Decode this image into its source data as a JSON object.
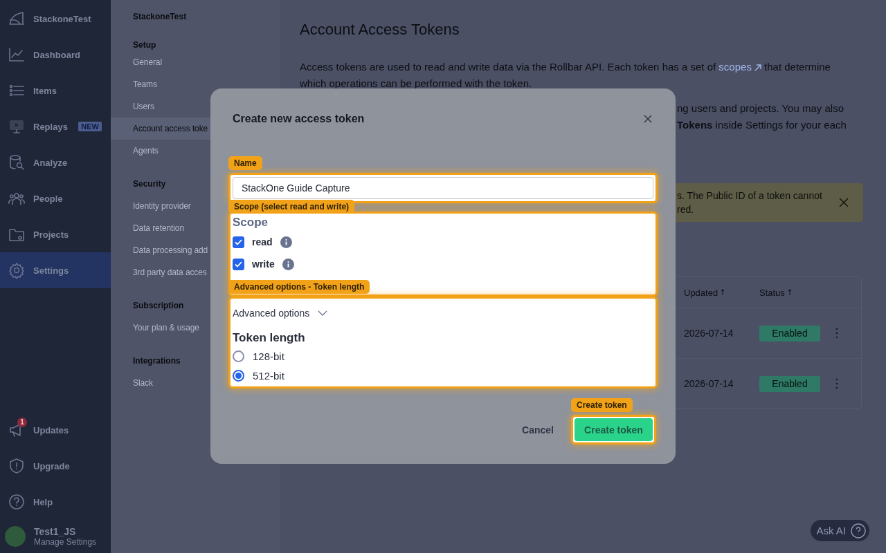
{
  "rail": {
    "brand": "StackoneTest",
    "items": [
      {
        "label": "Dashboard",
        "selected": false
      },
      {
        "label": "Items",
        "selected": false
      },
      {
        "label": "Replays",
        "selected": false,
        "badge": "NEW"
      },
      {
        "label": "Analyze",
        "selected": false
      },
      {
        "label": "People",
        "selected": false
      },
      {
        "label": "Projects",
        "selected": false
      },
      {
        "label": "Settings",
        "selected": true
      }
    ],
    "bottom_items": [
      {
        "label": "Updates",
        "badge": "1"
      },
      {
        "label": "Upgrade"
      },
      {
        "label": "Help"
      }
    ],
    "user": {
      "name": "Test1_JS",
      "subtitle": "Manage Settings"
    }
  },
  "settings_nav": {
    "title": "StackoneTest",
    "sections": [
      {
        "heading": "Setup",
        "items": [
          {
            "label": "General",
            "selected": false
          },
          {
            "label": "Teams",
            "selected": false
          },
          {
            "label": "Users",
            "selected": false
          },
          {
            "label": "Account access toke",
            "selected": true
          },
          {
            "label": "Agents",
            "selected": false
          }
        ]
      },
      {
        "heading": "Security",
        "items": [
          {
            "label": "Identity provider",
            "selected": false
          },
          {
            "label": "Data retention",
            "selected": false
          },
          {
            "label": "Data processing add",
            "selected": false
          },
          {
            "label": "3rd party data acces",
            "selected": false
          }
        ]
      },
      {
        "heading": "Subscription",
        "items": [
          {
            "label": "Your plan & usage",
            "selected": false
          }
        ]
      },
      {
        "heading": "Integrations",
        "items": [
          {
            "label": "Slack",
            "selected": false
          }
        ]
      }
    ]
  },
  "page": {
    "title": "Account Access Tokens",
    "intro": {
      "before": "Access tokens are used to read and write data via the Rollbar API. Each token has a set of ",
      "link": "scopes",
      "after": " that determine which operations can be performed with the token."
    },
    "note_lines": [
      "ng users and projects. You may also",
      "**Tokens** inside Settings for your each"
    ],
    "alert_lines": [
      "s. The Public ID of a token cannot",
      "red."
    ],
    "table": {
      "columns": [
        {
          "label": "Updated"
        },
        {
          "label": "Status"
        }
      ],
      "rows": [
        {
          "updated": "2026-07-14",
          "status": "Enabled"
        },
        {
          "updated": "2026-07-14",
          "status": "Enabled"
        }
      ]
    },
    "ask_ai": "Ask AI"
  },
  "dialog": {
    "title": "Create new access token",
    "name_field": {
      "value": "StackOne Guide Capture",
      "tag": "Name"
    },
    "scope": {
      "tag": "Scope (select read and write)",
      "heading": "Scope",
      "options": [
        {
          "label": "read",
          "checked": true
        },
        {
          "label": "write",
          "checked": true
        }
      ]
    },
    "advanced": {
      "tag": "Advanced options - Token length",
      "toggle": "Advanced options",
      "heading": "Token length",
      "options": [
        {
          "label": "128-bit",
          "selected": false
        },
        {
          "label": "512-bit",
          "selected": true
        }
      ]
    },
    "cancel": "Cancel",
    "create": {
      "label": "Create token",
      "tag": "Create token"
    }
  }
}
